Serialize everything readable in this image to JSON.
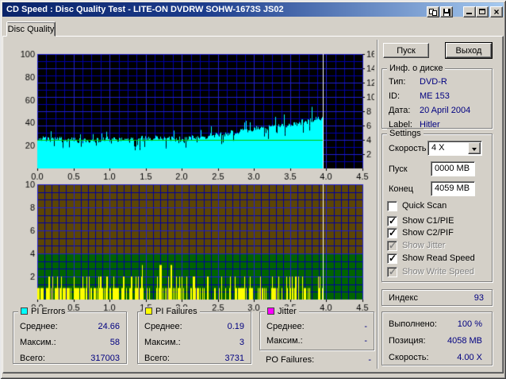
{
  "window": {
    "title": "CD Speed : Disc Quality Test - LITE-ON DVDRW SOHW-1673S JS02",
    "titlebar_icons": [
      "copy-icon",
      "save-icon",
      "minimize-icon",
      "maximize-icon",
      "close-icon"
    ]
  },
  "tab": {
    "label": "Disc Quality"
  },
  "actions": {
    "start": "Пуск",
    "exit": "Выход"
  },
  "disc_info": {
    "title": "Инф. о диске",
    "rows": [
      {
        "label": "Тип:",
        "value": "DVD-R"
      },
      {
        "label": "ID:",
        "value": "ME 153"
      },
      {
        "label": "Дата:",
        "value": "20 April 2004"
      },
      {
        "label": "Label:",
        "value": "Hitler"
      }
    ]
  },
  "settings": {
    "title": "Settings",
    "speed": {
      "label": "Скорость",
      "value": "4 X"
    },
    "start": {
      "label": "Пуск",
      "value": "0000 MB"
    },
    "end": {
      "label": "Конец",
      "value": "4059 MB"
    },
    "checkboxes": [
      {
        "label": "Quick Scan",
        "checked": false,
        "enabled": true
      },
      {
        "label": "Show C1/PIE",
        "checked": true,
        "enabled": true
      },
      {
        "label": "Show C2/PIF",
        "checked": true,
        "enabled": true
      },
      {
        "label": "Show Jitter",
        "checked": true,
        "enabled": false
      },
      {
        "label": "Show Read Speed",
        "checked": true,
        "enabled": true
      },
      {
        "label": "Show Write Speed",
        "checked": true,
        "enabled": false
      }
    ]
  },
  "index_panel": {
    "label": "Индекс",
    "value": "93"
  },
  "progress_panel": {
    "rows": [
      {
        "label": "Выполнено:",
        "value": "100 %"
      },
      {
        "label": "Позиция:",
        "value": "4058 MB"
      },
      {
        "label": "Скорость:",
        "value": "4.00 X"
      }
    ]
  },
  "legend_panels": [
    {
      "title": "PI Errors",
      "swatch_style": "background:#00FFFF",
      "rows": [
        {
          "label": "Среднее:",
          "value": "24.66"
        },
        {
          "label": "Максим.:",
          "value": "58"
        },
        {
          "label": "Всего:",
          "value": "317003"
        }
      ]
    },
    {
      "title": "PI Failures",
      "swatch_style": "background:#FFFF00",
      "rows": [
        {
          "label": "Среднее:",
          "value": "0.19"
        },
        {
          "label": "Максим.:",
          "value": "3"
        },
        {
          "label": "Всего:",
          "value": "3731"
        }
      ]
    },
    {
      "title": "Jitter",
      "swatch_style": "background:#FF00FF",
      "rows": [
        {
          "label": "Среднее:",
          "value": "-"
        },
        {
          "label": "Максим.:",
          "value": "-"
        }
      ],
      "extra": {
        "label": "PO Failures:",
        "value": "-"
      }
    }
  ],
  "chart_data": [
    {
      "type": "area",
      "name": "pi_errors_and_read_speed",
      "x_range": [
        0,
        4.5
      ],
      "x_tick_labels": [
        "0.0",
        "0.5",
        "1.0",
        "1.5",
        "2.0",
        "2.5",
        "3.0",
        "3.5",
        "4.0",
        "4.5"
      ],
      "y_left_range": [
        0,
        100
      ],
      "y_left_tick_labels": [
        "100",
        "80",
        "60",
        "40",
        "20"
      ],
      "y_right_range": [
        0,
        16
      ],
      "y_right_tick_labels": [
        "16",
        "14",
        "12",
        "10",
        "8",
        "6",
        "4",
        "2"
      ],
      "data_end_x": 3.95,
      "cursor_x": 3.95,
      "bg_color": "#000000",
      "grid_minor_color": "#0000A8",
      "grid_major_color": "#2020D0",
      "grid_minor_step_x": 0.125,
      "grid_major_step_x": 0.5,
      "noise_seed": 3,
      "series": [
        {
          "name": "PI Errors",
          "color": "#00FFFF",
          "style": "noisy-area",
          "axis": "left",
          "x": [
            0,
            0.25,
            0.5,
            0.75,
            1.0,
            1.25,
            1.5,
            1.75,
            2.0,
            2.25,
            2.5,
            2.75,
            3.0,
            3.25,
            3.5,
            3.75,
            3.95
          ],
          "mean": [
            26,
            25,
            24,
            24,
            25,
            24,
            26,
            26,
            25,
            27,
            29,
            31,
            34,
            36,
            38,
            41,
            44
          ],
          "peak": [
            34,
            34,
            32,
            31,
            33,
            31,
            35,
            34,
            33,
            36,
            38,
            41,
            45,
            48,
            52,
            55,
            58
          ],
          "dips": [
            {
              "x": 1.35,
              "value": 17
            }
          ]
        },
        {
          "name": "Read Speed",
          "color": "#00C800",
          "style": "line",
          "axis": "right",
          "value": 4.0
        }
      ]
    },
    {
      "type": "bar",
      "name": "pi_failures",
      "x_range": [
        0,
        4.5
      ],
      "x_tick_labels": [
        "0.0",
        "0.5",
        "1.0",
        "1.5",
        "2.0",
        "2.5",
        "3.0",
        "3.5",
        "4.0",
        "4.5"
      ],
      "y_range": [
        0,
        10
      ],
      "y_tick_labels": [
        "10",
        "8",
        "6",
        "4",
        "2"
      ],
      "data_end_x": 3.95,
      "cursor_x": 3.95,
      "zones": [
        {
          "from": 0,
          "to": 4,
          "color": "#006400"
        },
        {
          "from": 4,
          "to": 10,
          "color": "#5C4505"
        }
      ],
      "grid_minor_color": "#0000A0",
      "grid_major_color": "#2020D0",
      "noise_seed": 11,
      "series": [
        {
          "name": "PI Failures",
          "color": "#FFFF00",
          "style": "noisy-bars",
          "typical_heights": [
            1,
            2
          ],
          "max_height": 3,
          "bar_density": 0.62,
          "peaks": [
            {
              "x": 1.45,
              "h": 3,
              "w": 0.008
            },
            {
              "x": 1.7,
              "h": 3,
              "w": 0.02
            },
            {
              "x": 1.85,
              "h": 3,
              "w": 0.008
            }
          ],
          "quiet_zones": [
            [
              1.5,
              1.61
            ],
            [
              2.02,
              2.12
            ],
            [
              2.36,
              2.44
            ],
            [
              3.39,
              3.45
            ],
            [
              3.77,
              3.85
            ]
          ]
        }
      ]
    }
  ]
}
